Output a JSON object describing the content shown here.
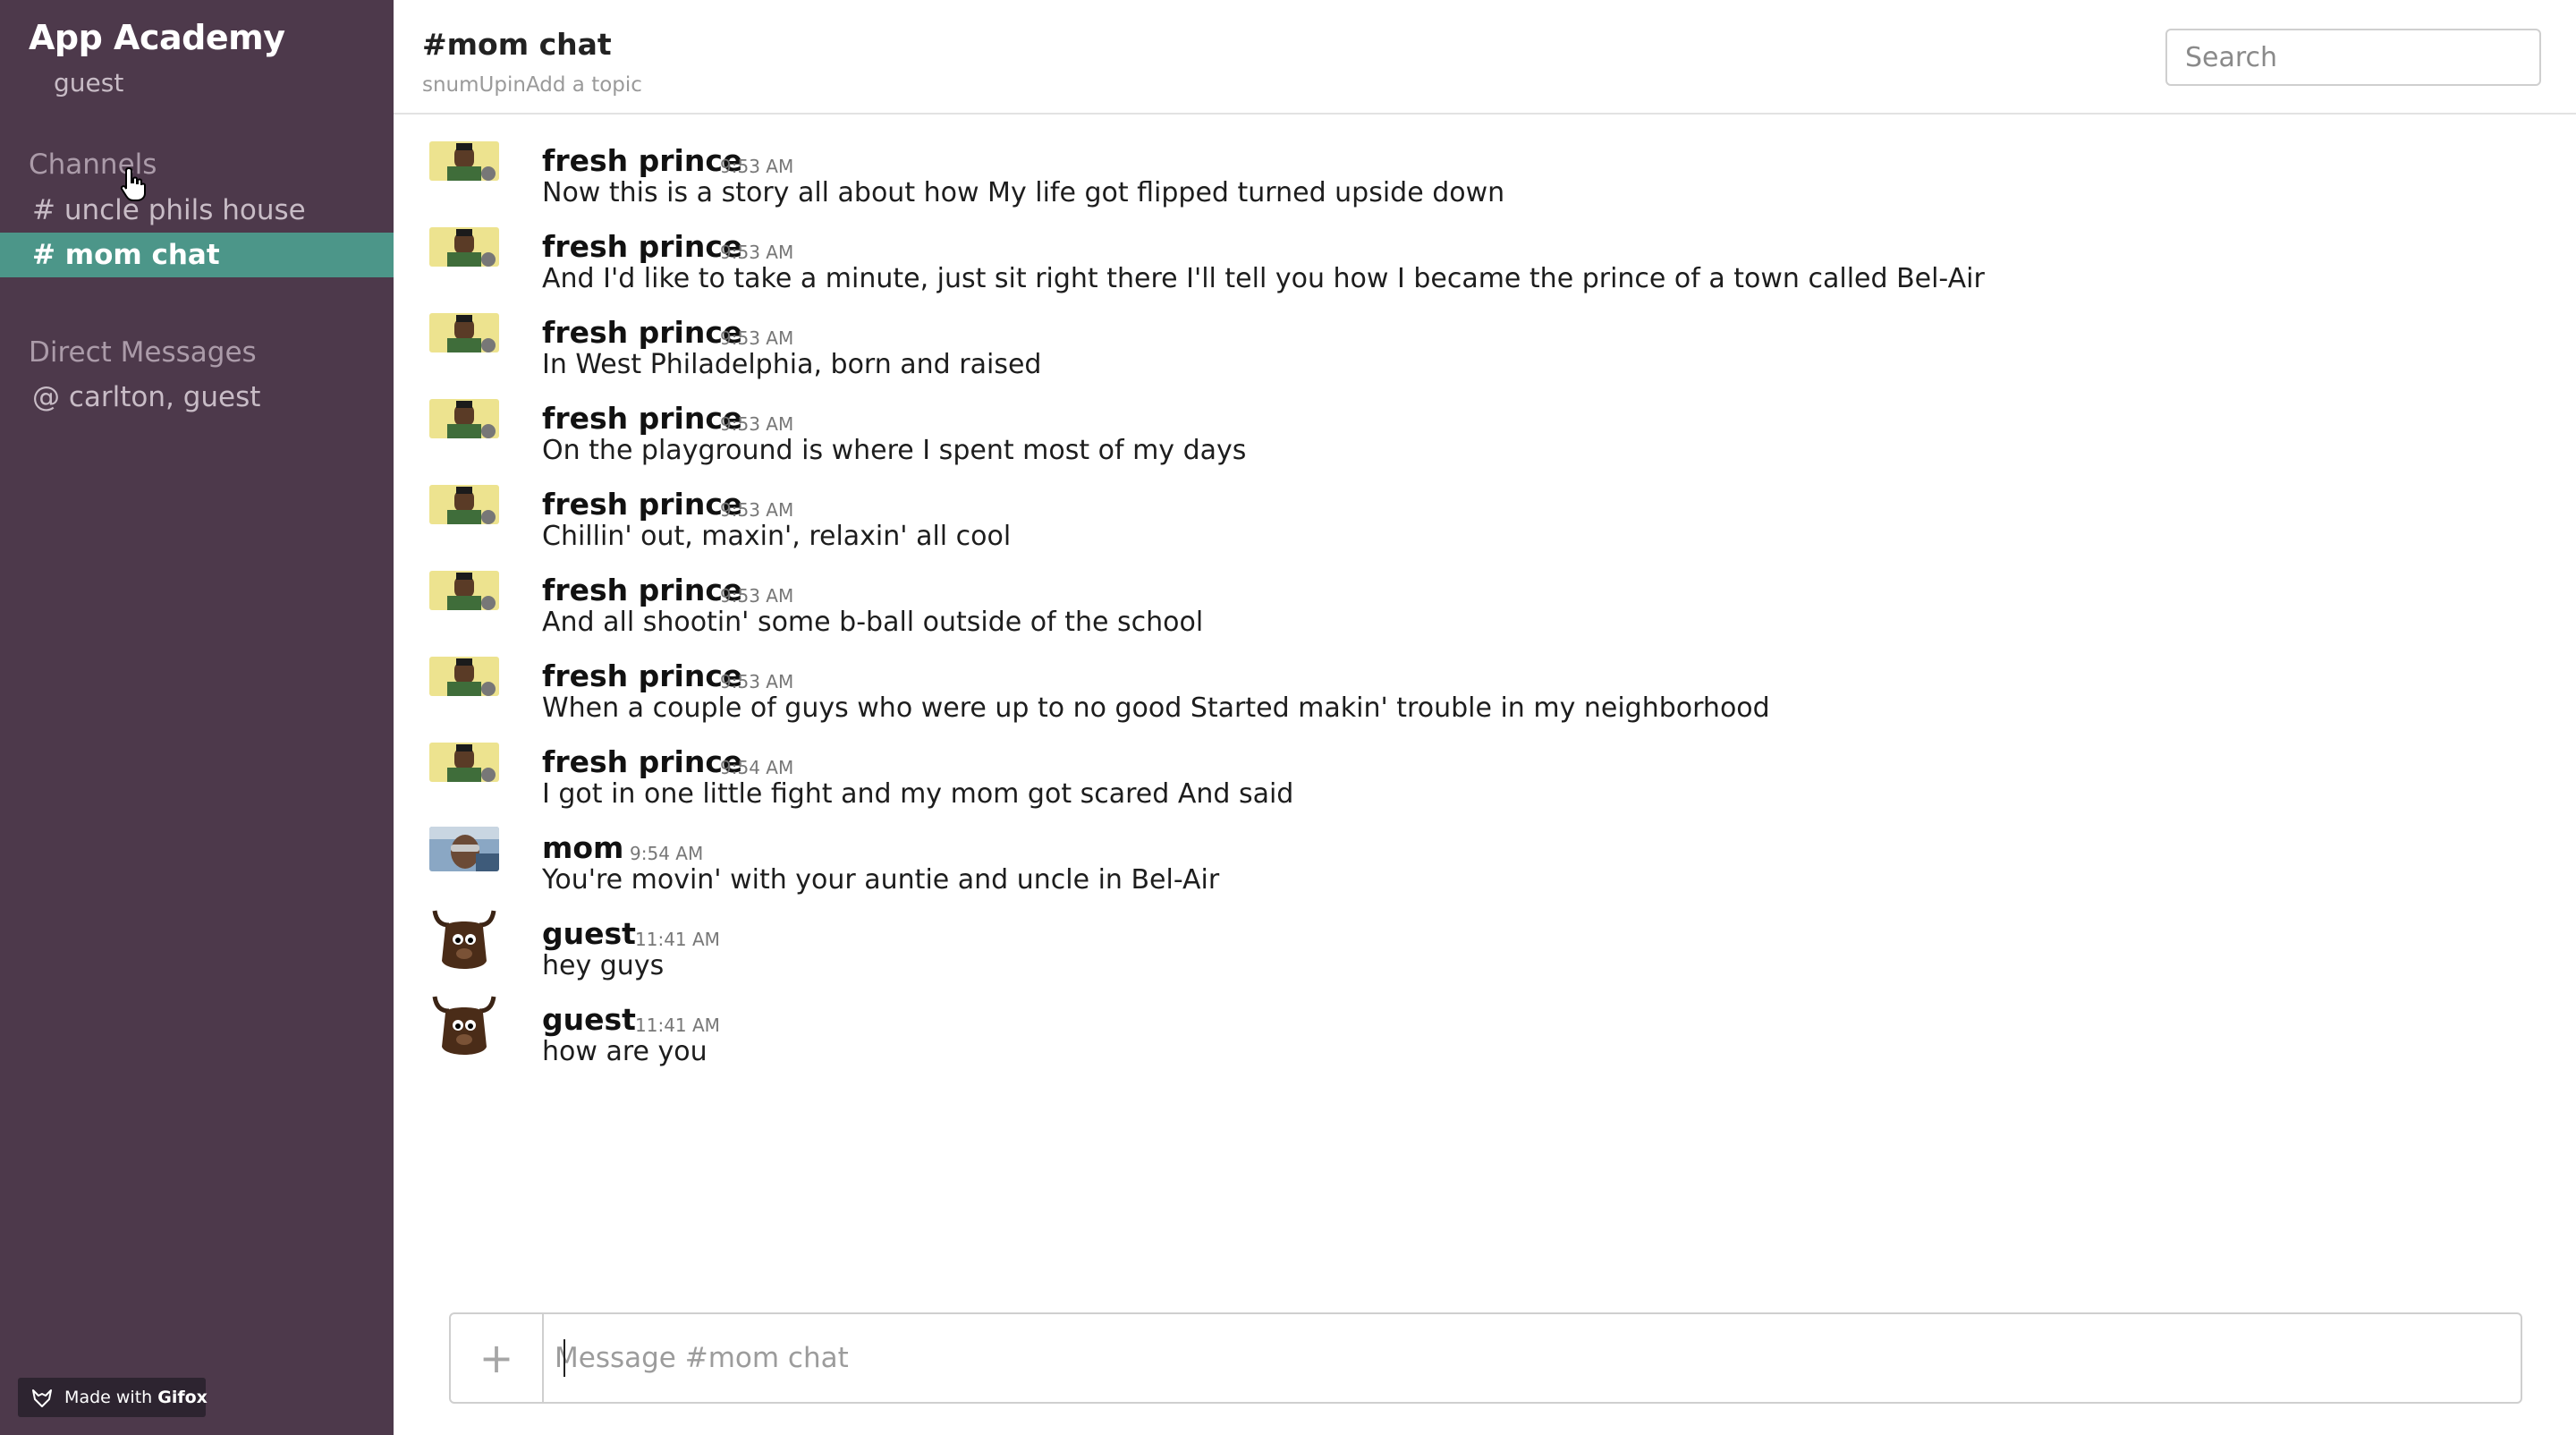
{
  "sidebar": {
    "team_name": "App Academy",
    "user_name": "guest",
    "channels_heading": "Channels",
    "channels": [
      {
        "label": "# uncle phils house",
        "active": false
      },
      {
        "label": "# mom chat",
        "active": true
      }
    ],
    "dm_heading": "Direct Messages",
    "direct_messages": [
      {
        "label": "@ carlton, guest"
      }
    ],
    "gifox_badge": {
      "prefix": "Made with",
      "brand": "Gifox"
    }
  },
  "header": {
    "channel_title": "#mom chat",
    "channel_meta": "snumUpinAdd a topic",
    "search_placeholder": "Search"
  },
  "messages": [
    {
      "author": "fresh prince",
      "time": "9:53 AM",
      "text": "Now this is a story all about how My life got flipped turned upside down",
      "avatar": "fresh-prince-avatar"
    },
    {
      "author": "fresh prince",
      "time": "9:53 AM",
      "text": "And I'd like to take a minute, just sit right there I'll tell you how I became the prince of a town called Bel-Air",
      "avatar": "fresh-prince-avatar"
    },
    {
      "author": "fresh prince",
      "time": "9:53 AM",
      "text": "In West Philadelphia, born and raised",
      "avatar": "fresh-prince-avatar"
    },
    {
      "author": "fresh prince",
      "time": "9:53 AM",
      "text": "On the playground is where I spent most of my days",
      "avatar": "fresh-prince-avatar"
    },
    {
      "author": "fresh prince",
      "time": "9:53 AM",
      "text": "Chillin' out, maxin', relaxin' all cool",
      "avatar": "fresh-prince-avatar"
    },
    {
      "author": "fresh prince",
      "time": "9:53 AM",
      "text": "And all shootin' some b-ball outside of the school",
      "avatar": "fresh-prince-avatar"
    },
    {
      "author": "fresh prince",
      "time": "9:53 AM",
      "text": "When a couple of guys who were up to no good Started makin' trouble in my neighborhood",
      "avatar": "fresh-prince-avatar"
    },
    {
      "author": "fresh prince",
      "time": "9:54 AM",
      "text": "I got in one little fight and my mom got scared And said",
      "avatar": "fresh-prince-avatar"
    },
    {
      "author": "mom",
      "time": "9:54 AM",
      "text": "You're movin' with your auntie and uncle in Bel-Air",
      "avatar": "mom-avatar"
    },
    {
      "author": "guest",
      "time": "11:41 AM",
      "text": "hey guys",
      "avatar": "yak-avatar"
    },
    {
      "author": "guest",
      "time": "11:41 AM",
      "text": "how are you",
      "avatar": "yak-avatar"
    }
  ],
  "composer": {
    "plus_label": "+",
    "placeholder": "Message #mom chat"
  },
  "colors": {
    "sidebar_bg": "#4d394b",
    "active_channel": "#4c9689"
  }
}
